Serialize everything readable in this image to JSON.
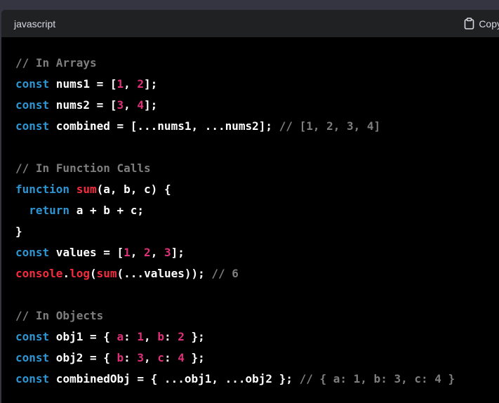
{
  "header": {
    "language": "javascript",
    "copy_label": "Copy"
  },
  "code_lines": [
    [
      {
        "t": "// In Arrays",
        "c": "cm"
      }
    ],
    [
      {
        "t": "const",
        "c": "kw"
      },
      {
        "t": " nums1 = [",
        "c": "plain"
      },
      {
        "t": "1",
        "c": "num"
      },
      {
        "t": ", ",
        "c": "plain"
      },
      {
        "t": "2",
        "c": "num"
      },
      {
        "t": "];",
        "c": "plain"
      }
    ],
    [
      {
        "t": "const",
        "c": "kw"
      },
      {
        "t": " nums2 = [",
        "c": "plain"
      },
      {
        "t": "3",
        "c": "num"
      },
      {
        "t": ", ",
        "c": "plain"
      },
      {
        "t": "4",
        "c": "num"
      },
      {
        "t": "];",
        "c": "plain"
      }
    ],
    [
      {
        "t": "const",
        "c": "kw"
      },
      {
        "t": " combined = [...nums1, ...nums2]; ",
        "c": "plain"
      },
      {
        "t": "// [1, 2, 3, 4]",
        "c": "cm"
      }
    ],
    [],
    [
      {
        "t": "// In Function Calls",
        "c": "cm"
      }
    ],
    [
      {
        "t": "function",
        "c": "kw"
      },
      {
        "t": " ",
        "c": "plain"
      },
      {
        "t": "sum",
        "c": "fn"
      },
      {
        "t": "(a, b, c) {",
        "c": "plain"
      }
    ],
    [
      {
        "t": "  ",
        "c": "plain"
      },
      {
        "t": "return",
        "c": "kw"
      },
      {
        "t": " a + b + c;",
        "c": "plain"
      }
    ],
    [
      {
        "t": "}",
        "c": "plain"
      }
    ],
    [
      {
        "t": "const",
        "c": "kw"
      },
      {
        "t": " values = [",
        "c": "plain"
      },
      {
        "t": "1",
        "c": "num"
      },
      {
        "t": ", ",
        "c": "plain"
      },
      {
        "t": "2",
        "c": "num"
      },
      {
        "t": ", ",
        "c": "plain"
      },
      {
        "t": "3",
        "c": "num"
      },
      {
        "t": "];",
        "c": "plain"
      }
    ],
    [
      {
        "t": "console",
        "c": "fn"
      },
      {
        "t": ".",
        "c": "plain"
      },
      {
        "t": "log",
        "c": "fn"
      },
      {
        "t": "(",
        "c": "plain"
      },
      {
        "t": "sum",
        "c": "fn"
      },
      {
        "t": "(...values)); ",
        "c": "plain"
      },
      {
        "t": "// 6",
        "c": "cm"
      }
    ],
    [],
    [
      {
        "t": "// In Objects",
        "c": "cm"
      }
    ],
    [
      {
        "t": "const",
        "c": "kw"
      },
      {
        "t": " obj1 = { ",
        "c": "plain"
      },
      {
        "t": "a",
        "c": "prop"
      },
      {
        "t": ": ",
        "c": "plain"
      },
      {
        "t": "1",
        "c": "num"
      },
      {
        "t": ", ",
        "c": "plain"
      },
      {
        "t": "b",
        "c": "prop"
      },
      {
        "t": ": ",
        "c": "plain"
      },
      {
        "t": "2",
        "c": "num"
      },
      {
        "t": " };",
        "c": "plain"
      }
    ],
    [
      {
        "t": "const",
        "c": "kw"
      },
      {
        "t": " obj2 = { ",
        "c": "plain"
      },
      {
        "t": "b",
        "c": "prop"
      },
      {
        "t": ": ",
        "c": "plain"
      },
      {
        "t": "3",
        "c": "num"
      },
      {
        "t": ", ",
        "c": "plain"
      },
      {
        "t": "c",
        "c": "prop"
      },
      {
        "t": ": ",
        "c": "plain"
      },
      {
        "t": "4",
        "c": "num"
      },
      {
        "t": " };",
        "c": "plain"
      }
    ],
    [
      {
        "t": "const",
        "c": "kw"
      },
      {
        "t": " combinedObj = { ...obj1, ...obj2 }; ",
        "c": "plain"
      },
      {
        "t": "// { a: 1, b: 3, c: 4 }",
        "c": "cm"
      }
    ]
  ]
}
